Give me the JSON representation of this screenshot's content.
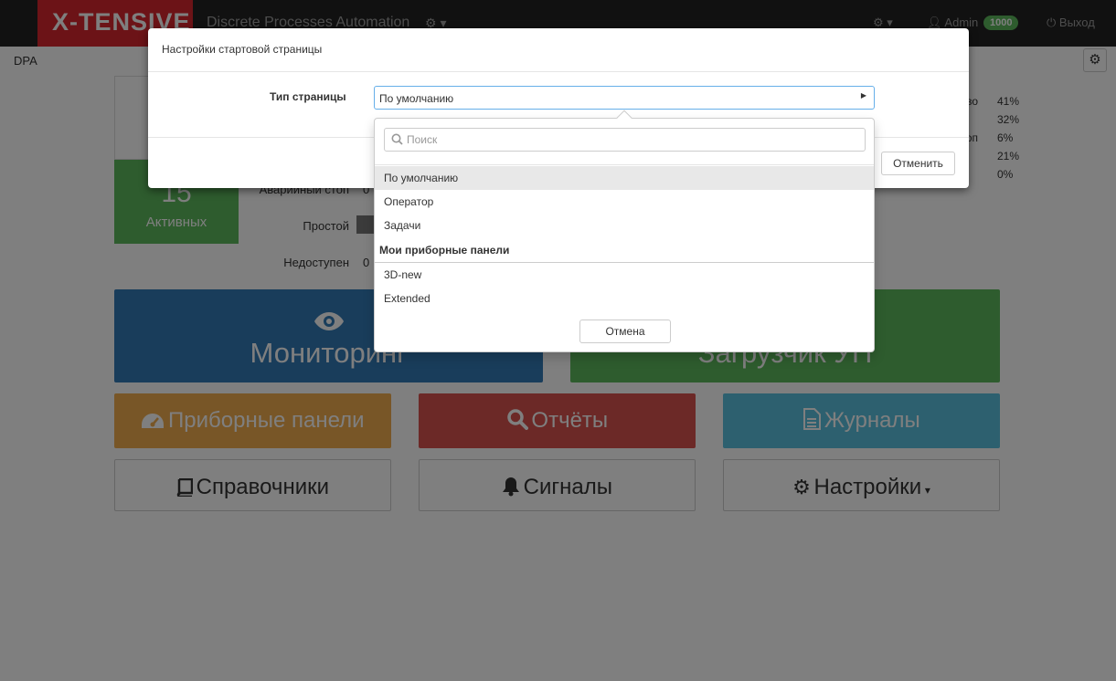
{
  "navbar": {
    "logo": "X-TENSIVE",
    "app_title": "Discrete Processes Automation",
    "user": "Admin",
    "badge": "1000",
    "logout": "Выход"
  },
  "page": {
    "breadcrumb": "DPA"
  },
  "stats": {
    "active_count": "15",
    "active_label": "Активных",
    "states": [
      {
        "label": "Аварийный стоп",
        "value": "0"
      },
      {
        "label": "Простой",
        "value": ""
      },
      {
        "label": "Недоступен",
        "value": "0"
      }
    ],
    "percentages": [
      {
        "label": "во",
        "value": "41%"
      },
      {
        "label": "",
        "value": "32%"
      },
      {
        "label": "стоп",
        "value": "6%"
      },
      {
        "label": "",
        "value": "21%"
      },
      {
        "label": "",
        "value": "0%"
      }
    ]
  },
  "tiles": {
    "monitoring": "Мониторинг",
    "loader": "Загрузчик УП",
    "dashboards": "Приборные панели",
    "reports": "Отчёты",
    "logs": "Журналы",
    "references": "Справочники",
    "signals": "Сигналы",
    "settings": "Настройки"
  },
  "modal": {
    "title": "Настройки стартовой страницы",
    "field_label": "Тип страницы",
    "selected_value": "По умолчанию",
    "cancel_label": "Отменить"
  },
  "dropdown": {
    "search_placeholder": "Поиск",
    "items": [
      "По умолчанию",
      "Оператор",
      "Задачи"
    ],
    "group_label": "Мои приборные панели",
    "group_items": [
      "3D-new",
      "Extended"
    ],
    "cancel_label": "Отмена"
  },
  "colors": {
    "navbar_bg": "#222222",
    "logo_bg": "#d9262e",
    "primary": "#337ab7",
    "success": "#5cb85c",
    "warning": "#f0ad4e",
    "danger": "#d9534f",
    "info": "#5bc0de"
  }
}
